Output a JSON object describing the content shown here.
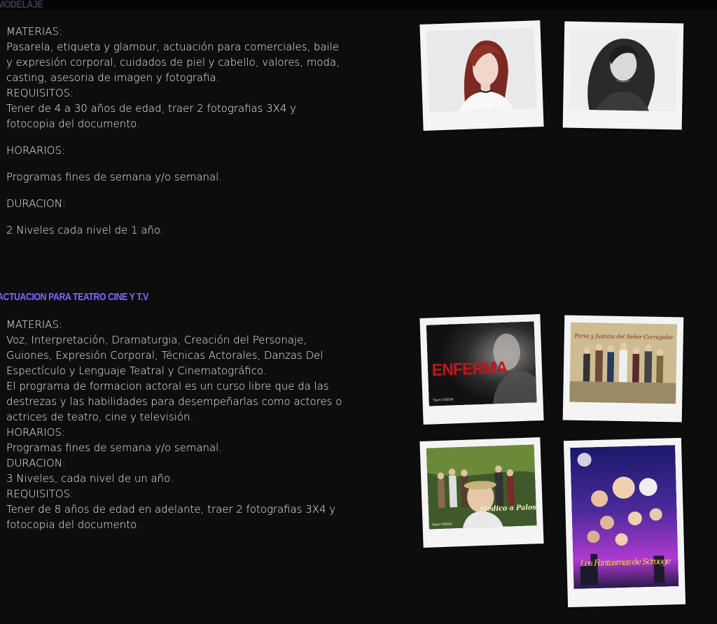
{
  "section1": {
    "title": "MODELAJE",
    "materias_label": "MATERIAS:",
    "materias_text": "Pasarela, etiqueta y glamour, actuación para comerciales, baile y expresión corporal, cuidados de piel y cabello, valores, moda, casting, asesoria de imagen y fotografia.",
    "requisitos_label": "REQUISITOS:",
    "requisitos_text": "Tener de 4 a 30 años de edad, traer 2 fotografias 3X4 y fotocopia del documento.",
    "horarios_label": "HORARIOS:",
    "horarios_text": "Programas fines de semana y/o semanal.",
    "duracion_label": "DURACION:",
    "duracion_text": "2 Niveles cada nivel de 1 año."
  },
  "section2": {
    "title": "ACTUACION PARA TEATRO CINE Y T.V",
    "materias_label": "MATERIAS:",
    "materias_text": "Voz, Interpretación, Dramaturgia, Creación del Personaje, Guiones, Expresión Corporal, Técnicas Actorales, Danzas Del Espectículo y Lenguaje Teatral y Cinematográfico.",
    "programa_text": "El programa de formacion actoral es un curso libre que da las destrezas y las habilidades para desempeñarlas como actores o actrices de teatro, cine y televisión.",
    "horarios_label": "HORARIOS:",
    "horarios_text": "Programas fines de semana y/o semanal.",
    "duracion_label": "DURACION:",
    "duracion_text": "3 Niveles, cada nivel de un año.",
    "requisitos_label": "REQUISITOS:",
    "requisitos_text": "Tener de 8 años de edad en adelante, traer 2 fotografias 3X4 y fotocopia del documento."
  },
  "posters": {
    "enferma_title": "ENFERMA",
    "enferma_logo": "Tayro VISION",
    "farsa_title": "Farsa y Justicia del Señor Corregidor",
    "medico_title": "Médico a Palos",
    "medico_logo": "Tayro VISION",
    "fantasmas_title": "Los Fantasmas de Scrooge"
  },
  "colors": {
    "background": "#0d0d0e",
    "heading_accent": "#7b6cff",
    "text": "#f2f2f2"
  }
}
